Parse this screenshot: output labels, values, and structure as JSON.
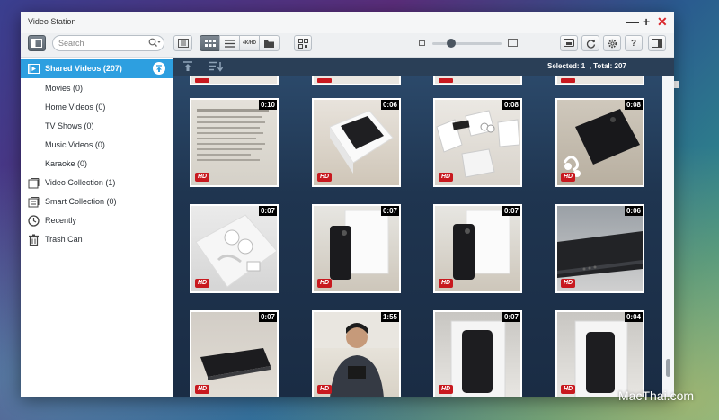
{
  "window": {
    "title": "Video Station"
  },
  "toolbar": {
    "search_placeholder": "Search",
    "view_hd_label": "4K/HD"
  },
  "sidebar": {
    "items": [
      {
        "label": "Shared Videos (207)"
      },
      {
        "label": "Movies (0)"
      },
      {
        "label": "Home Videos (0)"
      },
      {
        "label": "TV Shows (0)"
      },
      {
        "label": "Music Videos (0)"
      },
      {
        "label": "Karaoke (0)"
      },
      {
        "label": "Video Collection (1)"
      },
      {
        "label": "Smart Collection (0)"
      },
      {
        "label": "Recently"
      },
      {
        "label": "Trash Can"
      }
    ]
  },
  "main": {
    "selection_status": "Selected: 1  , Total: 207"
  },
  "videos": [
    {
      "duration": "0:10",
      "badge": "HD"
    },
    {
      "duration": "0:06",
      "badge": "HD"
    },
    {
      "duration": "0:08",
      "badge": "HD"
    },
    {
      "duration": "0:08",
      "badge": "HD"
    },
    {
      "duration": "0:07",
      "badge": "HD"
    },
    {
      "duration": "0:07",
      "badge": "HD"
    },
    {
      "duration": "0:07",
      "badge": "HD"
    },
    {
      "duration": "0:06",
      "badge": "HD"
    },
    {
      "duration": "0:07",
      "badge": "HD"
    },
    {
      "duration": "1:55",
      "badge": "HD"
    },
    {
      "duration": "0:07",
      "badge": "HD"
    },
    {
      "duration": "0:04",
      "badge": "HD"
    }
  ],
  "watermark": "MacThai.com",
  "colors": {
    "accent": "#2d9fe0",
    "close": "#d9262b",
    "hd_badge": "#c8191f"
  }
}
